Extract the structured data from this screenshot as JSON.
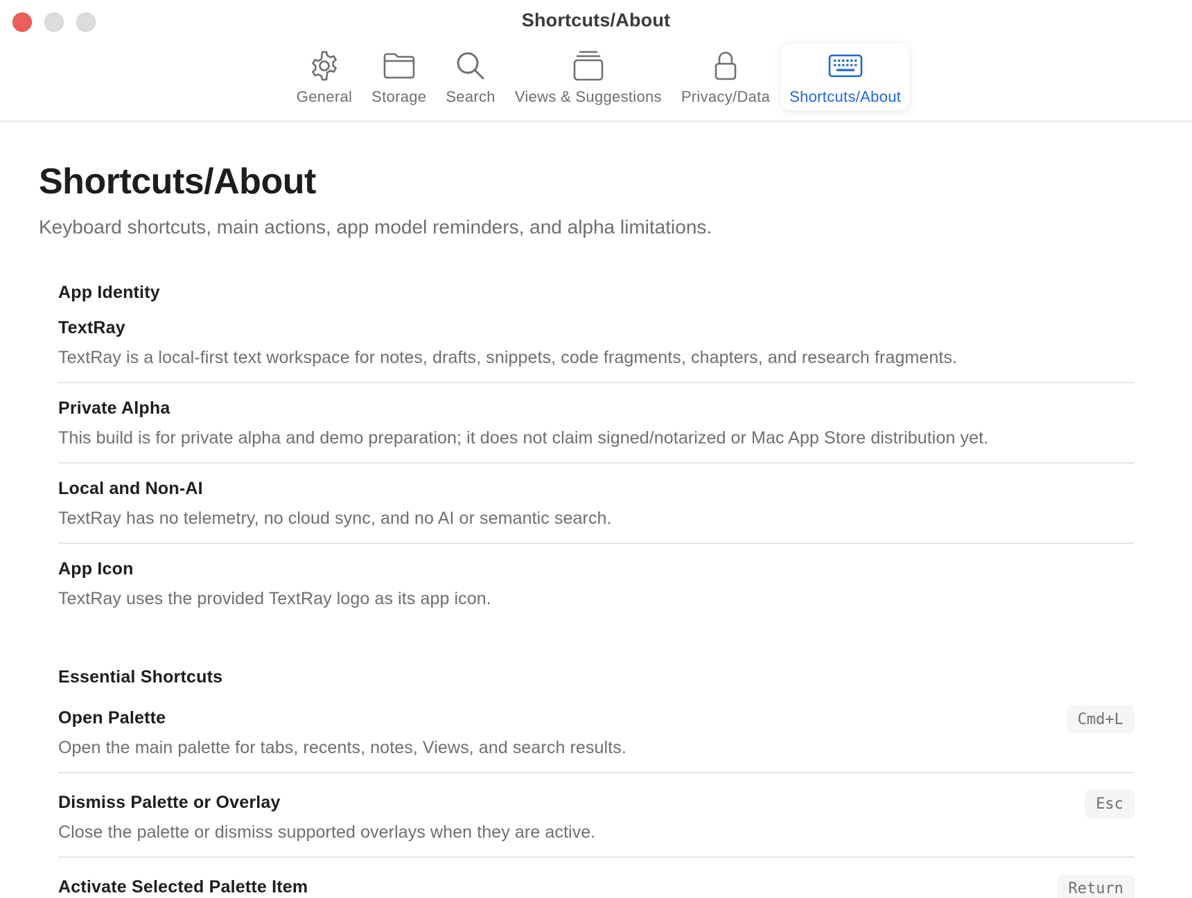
{
  "window": {
    "title": "Shortcuts/About"
  },
  "toolbar": {
    "tabs": [
      {
        "label": "General",
        "icon": "gear-icon"
      },
      {
        "label": "Storage",
        "icon": "folder-icon"
      },
      {
        "label": "Search",
        "icon": "magnifier-icon"
      },
      {
        "label": "Views & Suggestions",
        "icon": "stacked-cards-icon"
      },
      {
        "label": "Privacy/Data",
        "icon": "lock-icon"
      },
      {
        "label": "Shortcuts/About",
        "icon": "keyboard-icon",
        "active": true
      }
    ]
  },
  "page": {
    "title": "Shortcuts/About",
    "subtitle": "Keyboard shortcuts, main actions, app model reminders, and alpha limitations."
  },
  "app_identity": {
    "heading": "App Identity",
    "items": [
      {
        "title": "TextRay",
        "desc": "TextRay is a local-first text workspace for notes, drafts, snippets, code fragments, chapters, and research fragments."
      },
      {
        "title": "Private Alpha",
        "desc": "This build is for private alpha and demo preparation; it does not claim signed/notarized or Mac App Store distribution yet."
      },
      {
        "title": "Local and Non-AI",
        "desc": "TextRay has no telemetry, no cloud sync, and no AI or semantic search."
      },
      {
        "title": "App Icon",
        "desc": "TextRay uses the provided TextRay logo as its app icon."
      }
    ]
  },
  "shortcuts": {
    "heading": "Essential Shortcuts",
    "items": [
      {
        "title": "Open Palette",
        "desc": "Open the main palette for tabs, recents, notes, Views, and search results.",
        "key": "Cmd+L"
      },
      {
        "title": "Dismiss Palette or Overlay",
        "desc": "Close the palette or dismiss supported overlays when they are active.",
        "key": "Esc"
      },
      {
        "title": "Activate Selected Palette Item",
        "desc": "",
        "key": "Return"
      }
    ]
  },
  "colors": {
    "accent": "#2166d8",
    "close": "#ec5f5a"
  }
}
